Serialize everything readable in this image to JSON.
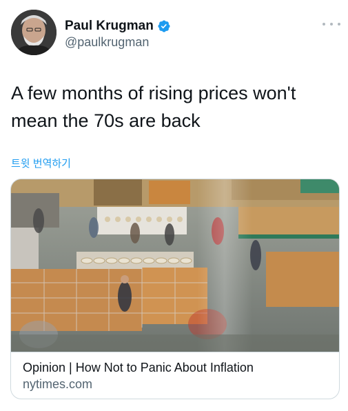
{
  "author": {
    "display_name": "Paul Krugman",
    "handle": "@paulkrugman",
    "verified": true,
    "avatar_icon": "user-photo-avatar",
    "verified_icon": "verified-badge-icon"
  },
  "tweet": {
    "text": "A few months of rising prices won't mean the 70s are back",
    "translate_label": "트윗 번역하기"
  },
  "link_card": {
    "title": "Opinion | How Not to Panic About Inflation",
    "domain": "nytimes.com",
    "image_subject": "warehouse-store-shoppers-photo"
  },
  "colors": {
    "accent": "#1d9bf0",
    "text_primary": "#0f1419",
    "text_secondary": "#536471",
    "border": "#cfd9de"
  }
}
